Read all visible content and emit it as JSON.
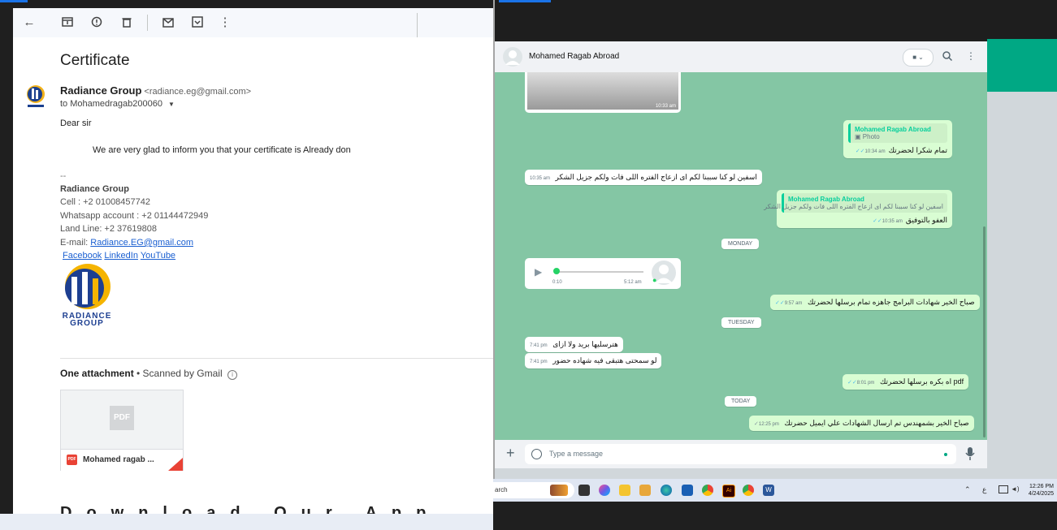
{
  "gmail": {
    "subject": "Certificate",
    "sender_name": "Radiance Group",
    "sender_email": "<radiance.eg@gmail.com>",
    "recipient": "to Mohamedragab200060",
    "greeting": "Dear sir",
    "message": "We are very glad to inform you that your certificate is Already don",
    "signature_dashes": "--",
    "sig_company": "Radiance Group",
    "sig_cell": "Cell : +2 01008457742",
    "sig_whatsapp": "Whatsapp account : +2 01144472949",
    "sig_landline": "Land Line: +2 37619808",
    "sig_email_label": "E-mail: ",
    "sig_email_link": "Radiance.EG@gmail.com",
    "links": [
      "Facebook",
      "LinkedIn",
      "YouTube"
    ],
    "logo_text_1": "RADIANCE",
    "logo_text_2": "GROUP",
    "attachments_heading": "One attachment",
    "scanned_text": " • Scanned by Gmail",
    "attachment_name": "Mohamed ragab ...",
    "pdf_placeholder": "PDF",
    "pdf_badge": "PDF",
    "download_banner": "Download Our App"
  },
  "whatsapp": {
    "contact_name": "Mohamed Ragab Abroad",
    "input_placeholder": "Type a message",
    "messages": [
      {
        "time": "10:33 am"
      },
      {
        "quote_name": "Mohamed Ragab Abroad",
        "quote_text": "Photo",
        "text": "تمام شكرا لحضرتك",
        "time": "10:34 am"
      },
      {
        "text": "اسفين لو كنا سببنا لكم اى ازعاج الفتره اللى فات ولكم جزيل الشكر",
        "time": "10:35 am"
      },
      {
        "quote_name": "Mohamed Ragab Abroad",
        "quote_text": "اسفين لو كنا سببنا لكم اى ازعاج الفتره اللى فات ولكم جزيل الشكر",
        "text": "العفو بالتوفيق",
        "time": "10:35 am"
      },
      {
        "day": "MONDAY"
      },
      {
        "voice_duration": "0:10",
        "time": "5:12 am"
      },
      {
        "text": "صباح الخير شهادات البرامج جاهزه تمام برسلها لحضرتك",
        "time": "9:57 am"
      },
      {
        "day": "TUESDAY"
      },
      {
        "text": "هترسليها بريد ولا ازاى",
        "time": "7:41 pm"
      },
      {
        "text": "لو سمحتى هتبقى فيه شهاده حضور",
        "time": "7:41 pm"
      },
      {
        "text": "pdf اه بكره برسلها لحضرتك",
        "time": "8:01 pm"
      },
      {
        "day": "TODAY"
      },
      {
        "text": "صباح الخير بشمهندس تم ارسال الشهادات علي ايميل حضرتك",
        "time": "12:25 pm"
      }
    ]
  },
  "taskbar": {
    "search_text": "arch",
    "lang": "ع",
    "time": "12:26 PM",
    "date": "4/24/2025"
  },
  "colors": {
    "wa_green": "#00a884",
    "wa_chat_bg": "#84c6a4",
    "outgoing_bubble": "#d9fdd3",
    "gmail_link": "#1a5fd1"
  }
}
